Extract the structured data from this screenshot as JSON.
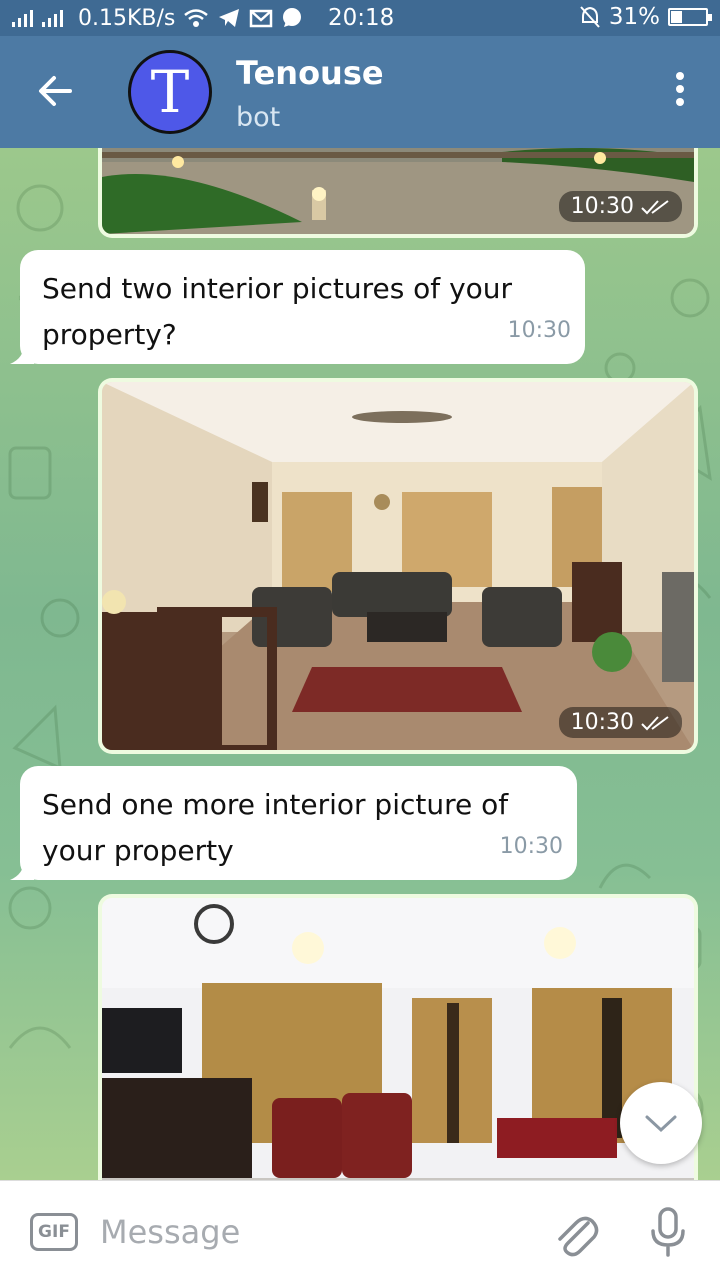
{
  "status_bar": {
    "network_speed": "0.15KB/s",
    "time": "20:18",
    "battery": "31%",
    "battery_level": 0.31
  },
  "header": {
    "avatar_letter": "T",
    "title": "Tenouse",
    "subtitle": "bot"
  },
  "messages": [
    {
      "type": "photo",
      "time": "10:30"
    },
    {
      "type": "text",
      "text_line1": "Send two interior pictures of your",
      "text_line2": "property?",
      "time": "10:30"
    },
    {
      "type": "photo",
      "time": "10:30"
    },
    {
      "type": "text",
      "text_line1": "Send one more interior picture of",
      "text_line2": "your property",
      "time": "10:30"
    },
    {
      "type": "photo"
    }
  ],
  "input": {
    "gif_label": "GIF",
    "placeholder": "Message"
  },
  "colors": {
    "header": "#4d7aa4",
    "status_bar": "#3f6a93",
    "avatar": "#4e58e8",
    "photo_bubble": "#eefbe0"
  }
}
